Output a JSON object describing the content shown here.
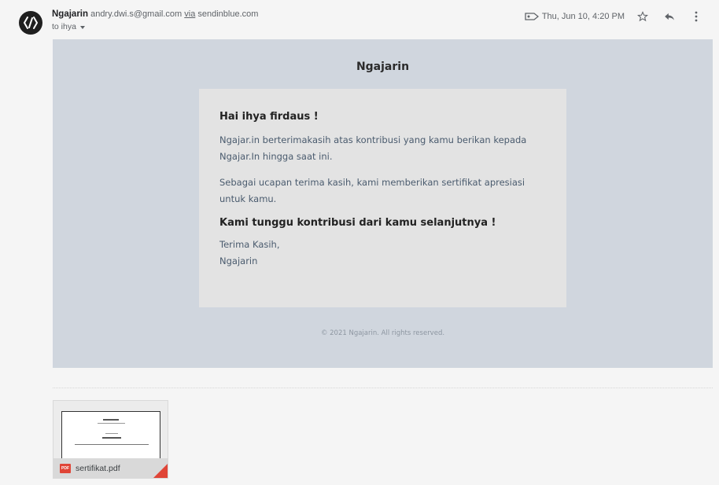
{
  "header": {
    "sender_name": "Ngajarin",
    "sender_email": "andry.dwi.s@gmail.com",
    "via_label": "via",
    "via_domain": "sendinblue.com",
    "to_label": "to ihya",
    "date": "Thu, Jun 10, 4:20 PM",
    "icons": [
      "label-icon",
      "star-icon",
      "reply-icon",
      "more-vert-icon"
    ]
  },
  "email": {
    "brand": "Ngajarin",
    "greeting": "Hai ihya firdaus !",
    "paragraph1": "Ngajar.in berterimakasih atas kontribusi yang kamu berikan kepada Ngajar.In hingga saat ini.",
    "paragraph2": "Sebagai ucapan terima kasih, kami memberikan sertifikat apresiasi untuk kamu.",
    "cta": "Kami tunggu kontribusi dari kamu selanjutnya !",
    "closing1": "Terima Kasih,",
    "closing2": "Ngajarin",
    "footer": "© 2021 Ngajarin. All rights reserved."
  },
  "attachment": {
    "type_badge": "PDF",
    "filename": "sertifikat.pdf"
  },
  "colors": {
    "body_bg": "#d0d6de",
    "card_bg": "#e3e3e3",
    "text_muted": "#4a5b6e",
    "pdf_red": "#e04537"
  }
}
